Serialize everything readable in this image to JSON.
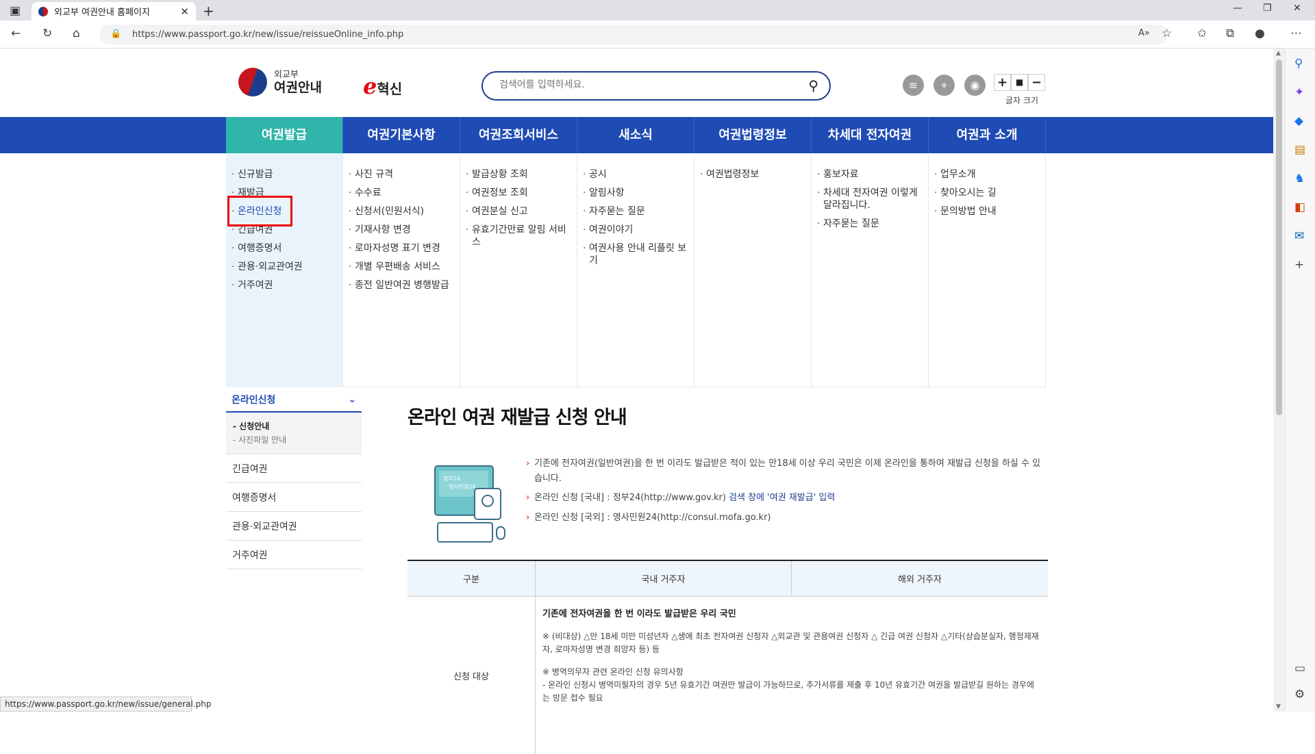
{
  "browser": {
    "tab_title": "외교부 여권안내 홈페이지",
    "url": "https://www.passport.go.kr/new/issue/reissueOnline_info.php",
    "status_url": "https://www.passport.go.kr/new/issue/general.php"
  },
  "header": {
    "logo_small": "외교부",
    "logo_big": "여권안내",
    "innovation_e": "e",
    "innovation_text": "혁신",
    "search_placeholder": "검색어를 입력하세요.",
    "font_size_label": "글자 크기",
    "font_plus": "+",
    "font_reset": "■",
    "font_minus": "−"
  },
  "gnb": [
    {
      "label": "여권발급"
    },
    {
      "label": "여권기본사항"
    },
    {
      "label": "여권조회서비스"
    },
    {
      "label": "새소식"
    },
    {
      "label": "여권법령정보"
    },
    {
      "label": "차세대 전자여권"
    },
    {
      "label": "여권과 소개"
    }
  ],
  "mega": [
    [
      "신규발급",
      "재발급",
      "온라인신청",
      "긴급여권",
      "여행증명서",
      "관용·외교관여권",
      "거주여권"
    ],
    [
      "사진 규격",
      "수수료",
      "신청서(민원서식)",
      "기재사항 변경",
      "로마자성명 표기 변경",
      "개별 우편배송 서비스",
      "종전 일반여권 병행발급"
    ],
    [
      "발급상황 조회",
      "여권정보 조회",
      "여권분실 신고",
      "유효기간만료 알림 서비스"
    ],
    [
      "공시",
      "알림사항",
      "자주묻는 질문",
      "여권이야기",
      "여권사용 안내 리플릿 보기"
    ],
    [
      "여권법령정보"
    ],
    [
      "홍보자료",
      "차세대 전자여권 이렇게 달라집니다.",
      "자주묻는 질문"
    ],
    [
      "업무소개",
      "찾아오시는 길",
      "문의방법 안내"
    ]
  ],
  "snb": {
    "head": "온라인신청",
    "sub_active": "- 신청안내",
    "sub_other": "- 사진파일 안내",
    "items": [
      "긴급여권",
      "여행증명서",
      "관용·외교관여권",
      "거주여권"
    ]
  },
  "content": {
    "title": "온라인 여권 재발급 신청 안내",
    "illust_line1": "정부24",
    "illust_line2": "영사민원24",
    "bullet1": "기존에 전자여권(일반여권)을 한 번 이라도 발급받은 적이 있는 만18세 이상 우리 국민은 이제 온라인을 통하여 재발급 신청을 하실 수 있습니다.",
    "bullet2_a": "온라인 신청 [국내] : 정부24(http://www.gov.kr) ",
    "bullet2_b": "검색 창에 '여권 재발급' 입력",
    "bullet3": "온라인 신청 [국외] : 영사민원24(http://consul.mofa.go.kr)",
    "table": {
      "headers": [
        "구분",
        "국내 거주자",
        "해외 거주자"
      ],
      "row_label": "신청 대상",
      "p1": "기존에 전자여권을 한 번 이라도 발급받은 우리 국민",
      "p2": "※ (비대상) △만 18세 미만 미성년자 △생애 최초 전자여권 신청자 △외교관 및 관용여권 신청자 △ 긴급 여권 신청자 △기타(상습분실자, 행정제재자, 로마자성명 변경 희망자 등) 등",
      "p3a": "※ 병역의무자 관련 온라인 신청 유의사항",
      "p3b": "- 온라인 신청시 병역미필자의 경우 5년 유효기간 여권만 발급이 가능하므로, 추가서류를 제출 후 10년 유효기간 여권을 발급받길 원하는 경우에는 방문 접수 필요"
    }
  },
  "colors": {
    "brand_blue": "#1f4bb4",
    "active_teal": "#2fb5a9",
    "highlight_red": "#ee0000"
  }
}
